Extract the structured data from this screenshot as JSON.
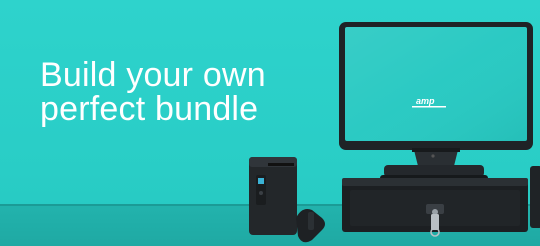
{
  "banner": {
    "headline_line1": "Build your own",
    "headline_line2": "perfect bundle",
    "screen_logo": "amp",
    "colors": {
      "background": "#2ed3cc",
      "counter": "#22b3ad",
      "headline": "#ffffff",
      "hardware": "#1f2326"
    },
    "products": [
      "pos-terminal-icon",
      "receipt-printer-icon",
      "cash-drawer-icon",
      "barcode-scanner-icon",
      "keys-icon"
    ]
  }
}
